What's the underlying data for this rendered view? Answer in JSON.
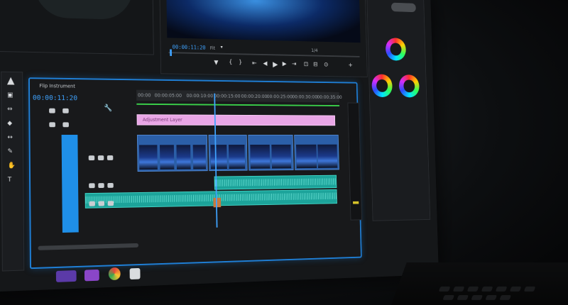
{
  "program_monitor": {
    "timecode": "00:00:11:20",
    "zoom": "Fit",
    "resolution": "1/4"
  },
  "timeline": {
    "title": "Flip Instrument",
    "timecode": "00:00:11:20",
    "ruler": [
      "00:00",
      "00:00:05:00",
      "00:00:10:00",
      "00:00:15:00",
      "00:00:20:00",
      "00:00:25:00",
      "00:00:30:00",
      "00:00:35:00"
    ],
    "title_clip": "Adjustment Layer",
    "playhead_fraction": 0.37
  },
  "colors": {
    "accent": "#1f7fd6",
    "video_clip": "#2b5fa8",
    "audio_clip": "#1ca39a",
    "title_clip": "#e9a6e6",
    "playhead": "#3fa3ff"
  },
  "icons": [
    "play-icon",
    "step-back-icon",
    "step-forward-icon",
    "marker-icon",
    "wrench-icon",
    "color-wheel-icon"
  ]
}
